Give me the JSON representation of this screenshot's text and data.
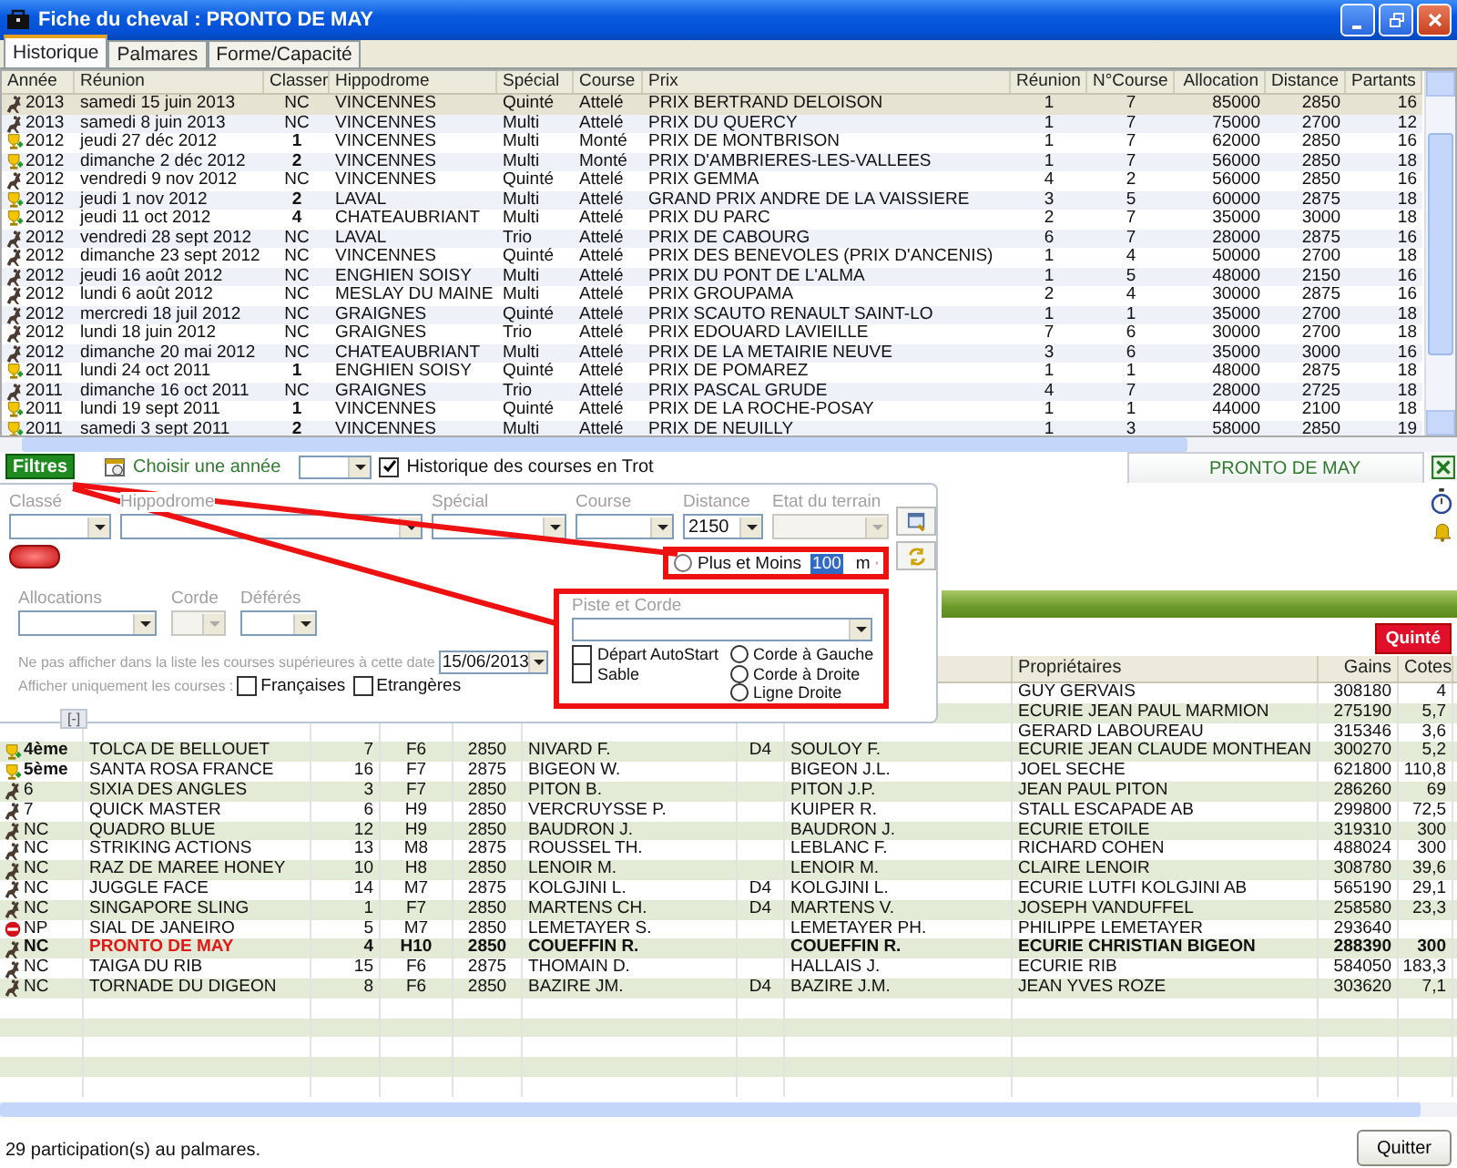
{
  "window": {
    "title": "Fiche du cheval : PRONTO DE MAY"
  },
  "tabs": [
    {
      "label": "Historique",
      "selected": true
    },
    {
      "label": "Palmares",
      "selected": false
    },
    {
      "label": "Forme/Capacité",
      "selected": false
    }
  ],
  "history": {
    "columns": [
      "Année",
      "Réunion",
      "Classer",
      "Hippodrome",
      "Spécial",
      "Course",
      "Prix",
      "Réunion",
      "N°Course",
      "Allocation",
      "Distance",
      "Partants"
    ],
    "rows": [
      {
        "kind": "unplaced",
        "selected": true,
        "cells": [
          "2013",
          "samedi 15 juin 2013",
          "NC",
          "VINCENNES",
          "Quinté",
          "Attelé",
          "PRIX BERTRAND DELOISON",
          "1",
          "7",
          "85000",
          "2850",
          "16"
        ]
      },
      {
        "kind": "unplaced",
        "selected": false,
        "cells": [
          "2013",
          "samedi 8 juin 2013",
          "NC",
          "VINCENNES",
          "Multi",
          "Attelé",
          "PRIX DU QUERCY",
          "1",
          "7",
          "75000",
          "2700",
          "12"
        ]
      },
      {
        "kind": "placed",
        "selected": false,
        "cells": [
          "2012",
          "jeudi 27 déc 2012",
          "1",
          "VINCENNES",
          "Multi",
          "Monté",
          "PRIX DE MONTBRISON",
          "1",
          "7",
          "62000",
          "2850",
          "16"
        ]
      },
      {
        "kind": "placed",
        "selected": false,
        "cells": [
          "2012",
          "dimanche 2 déc 2012",
          "2",
          "VINCENNES",
          "Multi",
          "Monté",
          "PRIX D'AMBRIERES-LES-VALLEES",
          "1",
          "7",
          "56000",
          "2850",
          "18"
        ]
      },
      {
        "kind": "unplaced",
        "selected": false,
        "cells": [
          "2012",
          "vendredi 9 nov 2012",
          "NC",
          "VINCENNES",
          "Quinté",
          "Attelé",
          "PRIX GEMMA",
          "4",
          "2",
          "56000",
          "2850",
          "16"
        ]
      },
      {
        "kind": "placed",
        "selected": false,
        "cells": [
          "2012",
          "jeudi 1 nov 2012",
          "2",
          "LAVAL",
          "Multi",
          "Attelé",
          "GRAND PRIX ANDRE DE LA VAISSIERE",
          "3",
          "5",
          "60000",
          "2875",
          "18"
        ]
      },
      {
        "kind": "placed",
        "selected": false,
        "cells": [
          "2012",
          "jeudi 11 oct 2012",
          "4",
          "CHATEAUBRIANT",
          "Multi",
          "Attelé",
          "PRIX DU PARC",
          "2",
          "7",
          "35000",
          "3000",
          "18"
        ]
      },
      {
        "kind": "unplaced",
        "selected": false,
        "cells": [
          "2012",
          "vendredi 28 sept 2012",
          "NC",
          "LAVAL",
          "Trio",
          "Attelé",
          "PRIX DE CABOURG",
          "6",
          "7",
          "28000",
          "2875",
          "16"
        ]
      },
      {
        "kind": "unplaced",
        "selected": false,
        "cells": [
          "2012",
          "dimanche 23 sept 2012",
          "NC",
          "VINCENNES",
          "Quinté",
          "Attelé",
          "PRIX DES BENEVOLES (PRIX D'ANCENIS)",
          "1",
          "4",
          "50000",
          "2700",
          "18"
        ]
      },
      {
        "kind": "unplaced",
        "selected": false,
        "cells": [
          "2012",
          "jeudi 16 août 2012",
          "NC",
          "ENGHIEN SOISY",
          "Multi",
          "Attelé",
          "PRIX DU PONT DE L'ALMA",
          "1",
          "5",
          "48000",
          "2150",
          "16"
        ]
      },
      {
        "kind": "unplaced",
        "selected": false,
        "cells": [
          "2012",
          "lundi 6 août 2012",
          "NC",
          "MESLAY DU MAINE",
          "Multi",
          "Attelé",
          "PRIX GROUPAMA",
          "2",
          "4",
          "30000",
          "2875",
          "16"
        ]
      },
      {
        "kind": "unplaced",
        "selected": false,
        "cells": [
          "2012",
          "mercredi 18 juil 2012",
          "NC",
          "GRAIGNES",
          "Quinté",
          "Attelé",
          "PRIX SCAUTO RENAULT SAINT-LO",
          "1",
          "1",
          "35000",
          "2700",
          "18"
        ]
      },
      {
        "kind": "unplaced",
        "selected": false,
        "cells": [
          "2012",
          "lundi 18 juin 2012",
          "NC",
          "GRAIGNES",
          "Trio",
          "Attelé",
          "PRIX EDOUARD LAVIEILLE",
          "7",
          "6",
          "30000",
          "2700",
          "18"
        ]
      },
      {
        "kind": "unplaced",
        "selected": false,
        "cells": [
          "2012",
          "dimanche 20 mai 2012",
          "NC",
          "CHATEAUBRIANT",
          "Multi",
          "Attelé",
          "PRIX DE LA METAIRIE NEUVE",
          "3",
          "6",
          "35000",
          "3000",
          "16"
        ]
      },
      {
        "kind": "placed",
        "selected": false,
        "cells": [
          "2011",
          "lundi 24 oct 2011",
          "1",
          "ENGHIEN SOISY",
          "Quinté",
          "Attelé",
          "PRIX DE POMAREZ",
          "1",
          "1",
          "48000",
          "2875",
          "18"
        ]
      },
      {
        "kind": "unplaced",
        "selected": false,
        "cells": [
          "2011",
          "dimanche 16 oct 2011",
          "NC",
          "GRAIGNES",
          "Trio",
          "Attelé",
          "PRIX PASCAL GRUDE",
          "4",
          "7",
          "28000",
          "2725",
          "18"
        ]
      },
      {
        "kind": "placed",
        "selected": false,
        "cells": [
          "2011",
          "lundi 19 sept 2011",
          "1",
          "VINCENNES",
          "Quinté",
          "Attelé",
          "PRIX DE LA ROCHE-POSAY",
          "1",
          "1",
          "44000",
          "2100",
          "18"
        ]
      },
      {
        "kind": "placed",
        "selected": false,
        "cells": [
          "2011",
          "samedi 3 sept 2011",
          "2",
          "VINCENNES",
          "Multi",
          "Attelé",
          "PRIX DE NEUILLY",
          "1",
          "3",
          "58000",
          "2850",
          "19"
        ]
      }
    ]
  },
  "filter_bar": {
    "button": "Filtres",
    "year_label": "Choisir une année",
    "trot_history": {
      "label": "Historique des courses en Trot",
      "checked": true
    },
    "horse_tab": "PRONTO DE MAY"
  },
  "filters": {
    "fields": [
      {
        "label": "Classé",
        "disabled": false
      },
      {
        "label": "Hippodrome",
        "disabled": false
      },
      {
        "label": "Spécial",
        "disabled": false
      },
      {
        "label": "Course",
        "disabled": false
      },
      {
        "label": "Distance",
        "disabled": false,
        "value": "2150"
      },
      {
        "label": "Etat du terrain",
        "disabled": true
      }
    ],
    "plus_minus": {
      "label": "Plus et Moins",
      "selected": false,
      "value": "100",
      "unit": "m"
    },
    "fields2": [
      {
        "label": "Allocations",
        "disabled": false
      },
      {
        "label": "Corde",
        "disabled": true
      },
      {
        "label": "Déférés",
        "disabled": false
      }
    ],
    "date_filter": {
      "label": "Ne pas afficher dans la liste les courses supérieures à cette date",
      "value": "15/06/2013"
    },
    "origin": {
      "label": "Afficher uniquement les courses :",
      "options": [
        {
          "label": "Françaises",
          "checked": false
        },
        {
          "label": "Etrangères",
          "checked": false
        }
      ]
    },
    "track": {
      "label": "Piste et Corde",
      "checks": [
        {
          "label": "Départ AutoStart",
          "checked": false
        },
        {
          "label": "Sable",
          "checked": false
        }
      ],
      "radios": [
        {
          "label": "Corde à Gauche",
          "selected": false
        },
        {
          "label": "Corde à Droite",
          "selected": false
        },
        {
          "label": "Ligne Droite",
          "selected": false
        }
      ]
    },
    "collapse": "[-]"
  },
  "race_badge": "Quinté",
  "results": {
    "columns": [
      "Propriétaires",
      "Gains",
      "Cotes"
    ],
    "rows": [
      {
        "owner": "GUY GERVAIS",
        "gains": "308180",
        "odds": "4"
      },
      {
        "owner": "ECURIE JEAN PAUL MARMION",
        "gains": "275190",
        "odds": "5,7"
      },
      {
        "owner": "GERARD LABOUREAU",
        "gains": "315346",
        "odds": "3,6"
      },
      {
        "kind": "placed",
        "place": "4ème",
        "horse": "TOLCA DE BELLOUET",
        "number": "7",
        "corde": "F6",
        "distance": "2850",
        "driver": "NIVARD F.",
        "flag": "D4",
        "trainer": "SOULOY F.",
        "owner": "ECURIE JEAN CLAUDE MONTHEAN",
        "gains": "300270",
        "odds": "5,2"
      },
      {
        "kind": "placed",
        "place": "5ème",
        "horse": "SANTA ROSA FRANCE",
        "number": "16",
        "corde": "F7",
        "distance": "2875",
        "driver": "BIGEON W.",
        "trainer": "BIGEON J.L.",
        "owner": "JOEL SECHE",
        "gains": "621800",
        "odds": "110,8"
      },
      {
        "kind": "unplaced",
        "place": "6",
        "horse": "SIXIA DES ANGLES",
        "number": "3",
        "corde": "F7",
        "distance": "2850",
        "driver": "PITON B.",
        "trainer": "PITON J.P.",
        "owner": "JEAN PAUL PITON",
        "gains": "286260",
        "odds": "69"
      },
      {
        "kind": "unplaced",
        "place": "7",
        "horse": "QUICK MASTER",
        "number": "6",
        "corde": "H9",
        "distance": "2850",
        "driver": "VERCRUYSSE P.",
        "trainer": "KUIPER R.",
        "owner": "STALL ESCAPADE AB",
        "gains": "299800",
        "odds": "72,5"
      },
      {
        "kind": "unplaced",
        "place": "NC",
        "horse": "QUADRO BLUE",
        "number": "12",
        "corde": "H9",
        "distance": "2850",
        "driver": "BAUDRON J.",
        "trainer": "BAUDRON J.",
        "owner": "ECURIE ETOILE",
        "gains": "319310",
        "odds": "300"
      },
      {
        "kind": "unplaced",
        "place": "NC",
        "horse": "STRIKING ACTIONS",
        "number": "13",
        "corde": "M8",
        "distance": "2875",
        "driver": "ROUSSEL TH.",
        "trainer": "LEBLANC F.",
        "owner": "RICHARD COHEN",
        "gains": "488024",
        "odds": "300"
      },
      {
        "kind": "unplaced",
        "place": "NC",
        "horse": "RAZ DE MAREE HONEY",
        "number": "10",
        "corde": "H8",
        "distance": "2850",
        "driver": "LENOIR M.",
        "trainer": "LENOIR M.",
        "owner": "CLAIRE LENOIR",
        "gains": "308780",
        "odds": "39,6"
      },
      {
        "kind": "unplaced",
        "place": "NC",
        "horse": "JUGGLE FACE",
        "number": "14",
        "corde": "M7",
        "distance": "2875",
        "driver": "KOLGJINI L.",
        "flag": "D4",
        "trainer": "KOLGJINI L.",
        "owner": "ECURIE LUTFI KOLGJINI AB",
        "gains": "565190",
        "odds": "29,1"
      },
      {
        "kind": "unplaced",
        "place": "NC",
        "horse": "SINGAPORE SLING",
        "number": "1",
        "corde": "F7",
        "distance": "2850",
        "driver": "MARTENS CH.",
        "flag": "D4",
        "trainer": "MARTENS V.",
        "owner": "JOSEPH VANDUFFEL",
        "gains": "258580",
        "odds": "23,3"
      },
      {
        "kind": "nonstarter",
        "place": "NP",
        "horse": "SIAL DE JANEIRO",
        "number": "5",
        "corde": "M7",
        "distance": "2850",
        "driver": "LEMETAYER S.",
        "trainer": "LEMETAYER PH.",
        "owner": "PHILIPPE LEMETAYER",
        "gains": "293640"
      },
      {
        "kind": "subject",
        "place": "NC",
        "horse": "PRONTO DE MAY",
        "number": "4",
        "corde": "H10",
        "distance": "2850",
        "driver": "COUEFFIN R.",
        "trainer": "COUEFFIN R.",
        "owner": "ECURIE CHRISTIAN BIGEON",
        "gains": "288390",
        "odds": "300"
      },
      {
        "kind": "unplaced",
        "place": "NC",
        "horse": "TAIGA DU RIB",
        "number": "15",
        "corde": "F6",
        "distance": "2875",
        "driver": "THOMAIN D.",
        "trainer": "HALLAIS J.",
        "owner": "ECURIE RIB",
        "gains": "584050",
        "odds": "183,3"
      },
      {
        "kind": "unplaced",
        "place": "NC",
        "horse": "TORNADE DU DIGEON",
        "number": "8",
        "corde": "F6",
        "distance": "2850",
        "driver": "BAZIRE JM.",
        "flag": "D4",
        "trainer": "BAZIRE J.M.",
        "owner": "JEAN YVES ROZE",
        "gains": "303620",
        "odds": "7,1"
      }
    ]
  },
  "status_bar": {
    "text": "29 participation(s) au palmares."
  },
  "quit_button": "Quitter"
}
